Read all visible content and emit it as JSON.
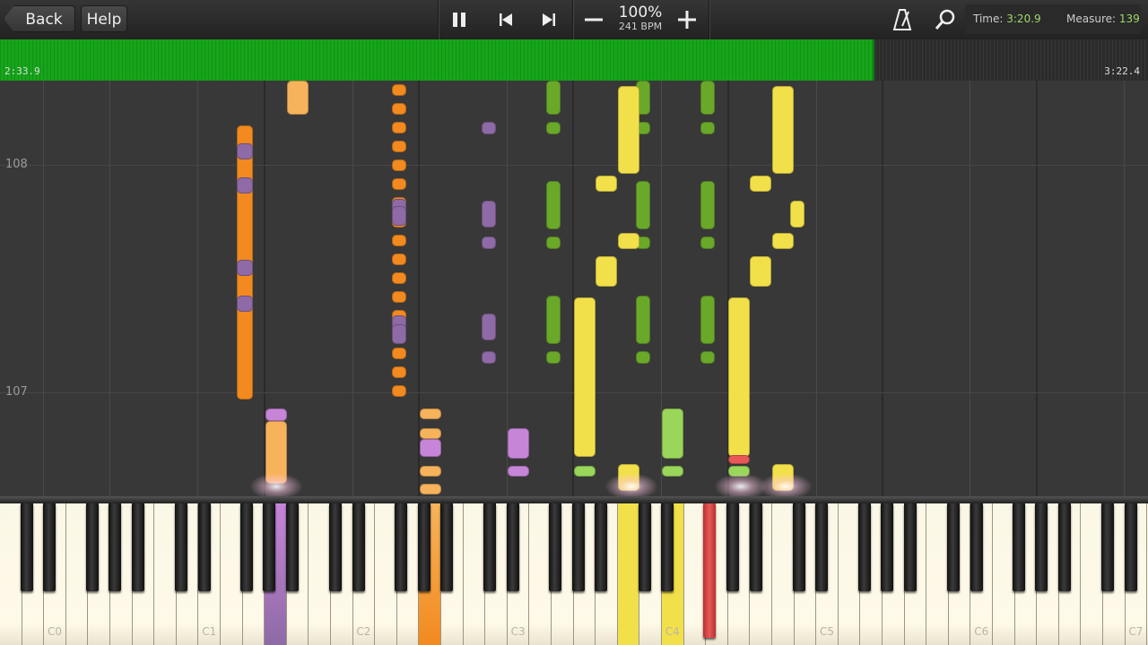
{
  "toolbar": {
    "back_label": "Back",
    "help_label": "Help",
    "speed_percent": "100%",
    "speed_bpm": "241 BPM"
  },
  "info": {
    "time_label": "Time:",
    "time_value": "3:20.9",
    "measure_label": "Measure:",
    "measure_value": "139"
  },
  "progress": {
    "elapsed": "2:33.9",
    "total": "3:22.4",
    "fraction": 0.76
  },
  "measures": [
    "108",
    "107"
  ],
  "keyboard": {
    "octave_labels": [
      "C0",
      "C1",
      "C2",
      "C3",
      "C4",
      "C5",
      "C6",
      "C7"
    ]
  },
  "colors": {
    "orange": "#f28a1f",
    "light_orange": "#f7b35b",
    "purple": "#8e6aa6",
    "light_purple": "#c785d8",
    "green": "#6aa82a",
    "light_green": "#9ad65a",
    "yellow": "#f2e04a",
    "red": "#e85858",
    "progress_green": "#16a51a"
  }
}
